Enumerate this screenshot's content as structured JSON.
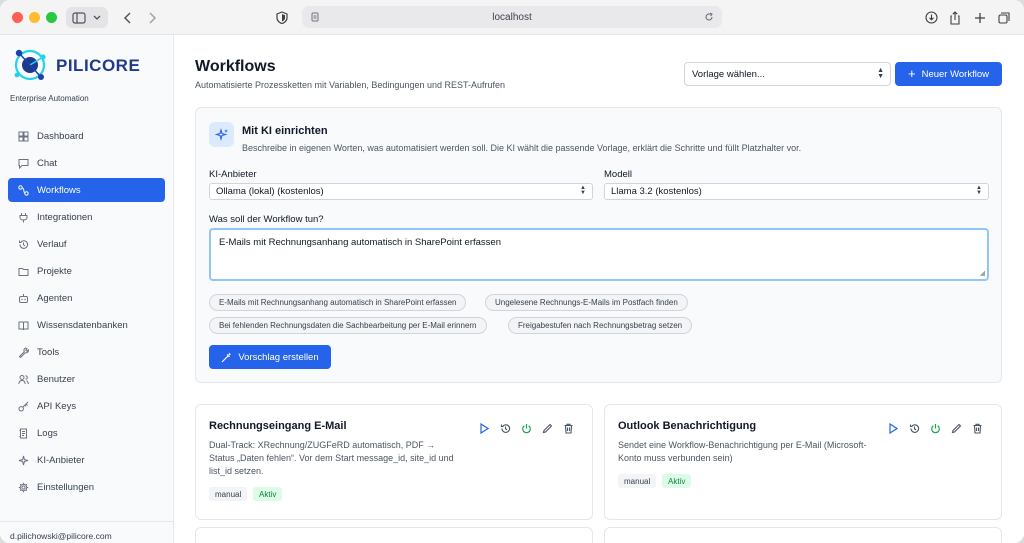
{
  "browser": {
    "url": "localhost"
  },
  "brand": {
    "name": "PILICORE",
    "tagline": "Enterprise Automation"
  },
  "sidebar": {
    "items": [
      {
        "label": "Dashboard",
        "icon": "grid-icon",
        "active": false
      },
      {
        "label": "Chat",
        "icon": "chat-icon",
        "active": false
      },
      {
        "label": "Workflows",
        "icon": "workflow-icon",
        "active": true
      },
      {
        "label": "Integrationen",
        "icon": "plug-icon",
        "active": false
      },
      {
        "label": "Verlauf",
        "icon": "history-icon",
        "active": false
      },
      {
        "label": "Projekte",
        "icon": "folder-icon",
        "active": false
      },
      {
        "label": "Agenten",
        "icon": "bot-icon",
        "active": false
      },
      {
        "label": "Wissensdatenbanken",
        "icon": "book-icon",
        "active": false
      },
      {
        "label": "Tools",
        "icon": "wrench-icon",
        "active": false
      },
      {
        "label": "Benutzer",
        "icon": "users-icon",
        "active": false
      },
      {
        "label": "API Keys",
        "icon": "key-icon",
        "active": false
      },
      {
        "label": "Logs",
        "icon": "logs-icon",
        "active": false
      },
      {
        "label": "KI-Anbieter",
        "icon": "sparkle-icon",
        "active": false
      },
      {
        "label": "Einstellungen",
        "icon": "gear-icon",
        "active": false
      }
    ],
    "user_email": "d.pilichowski@pilicore.com"
  },
  "page": {
    "title": "Workflows",
    "subtitle": "Automatisierte Prozessketten mit Variablen, Bedingungen und REST-Aufrufen",
    "template_select": "Vorlage wählen...",
    "new_button": "Neuer Workflow"
  },
  "ai": {
    "title": "Mit KI einrichten",
    "description": "Beschreibe in eigenen Worten, was automatisiert werden soll. Die KI wählt die passende Vorlage, erklärt die Schritte und füllt Platzhalter vor.",
    "provider_label": "KI-Anbieter",
    "provider_value": "Ollama (lokal) (kostenlos)",
    "model_label": "Modell",
    "model_value": "Llama 3.2 (kostenlos)",
    "prompt_label": "Was soll der Workflow tun?",
    "prompt_value": "E-Mails mit Rechnungsanhang automatisch in SharePoint erfassen",
    "suggestions": [
      "E-Mails mit Rechnungsanhang automatisch in SharePoint erfassen",
      "Ungelesene Rechnungs-E-Mails im Postfach finden",
      "Bei fehlenden Rechnungsdaten die Sachbearbeitung per E-Mail erinnern",
      "Freigabestufen nach Rechnungsbetrag setzen"
    ],
    "submit": "Vorschlag erstellen"
  },
  "workflows": [
    {
      "title": "Rechnungseingang E-Mail",
      "description": "Dual-Track: XRechnung/ZUGFeRD automatisch, PDF → Status „Daten fehlen“. Vor dem Start message_id, site_id und list_id setzen.",
      "trigger": "manual",
      "status": "Aktiv"
    },
    {
      "title": "Outlook Benachrichtigung",
      "description": "Sendet eine Workflow-Benachrichtigung per E-Mail (Microsoft-Konto muss verbunden sein)",
      "trigger": "manual",
      "status": "Aktiv"
    }
  ],
  "colors": {
    "primary": "#2563eb",
    "active_tag": "#15803d",
    "brand": "#1e3a8a"
  }
}
